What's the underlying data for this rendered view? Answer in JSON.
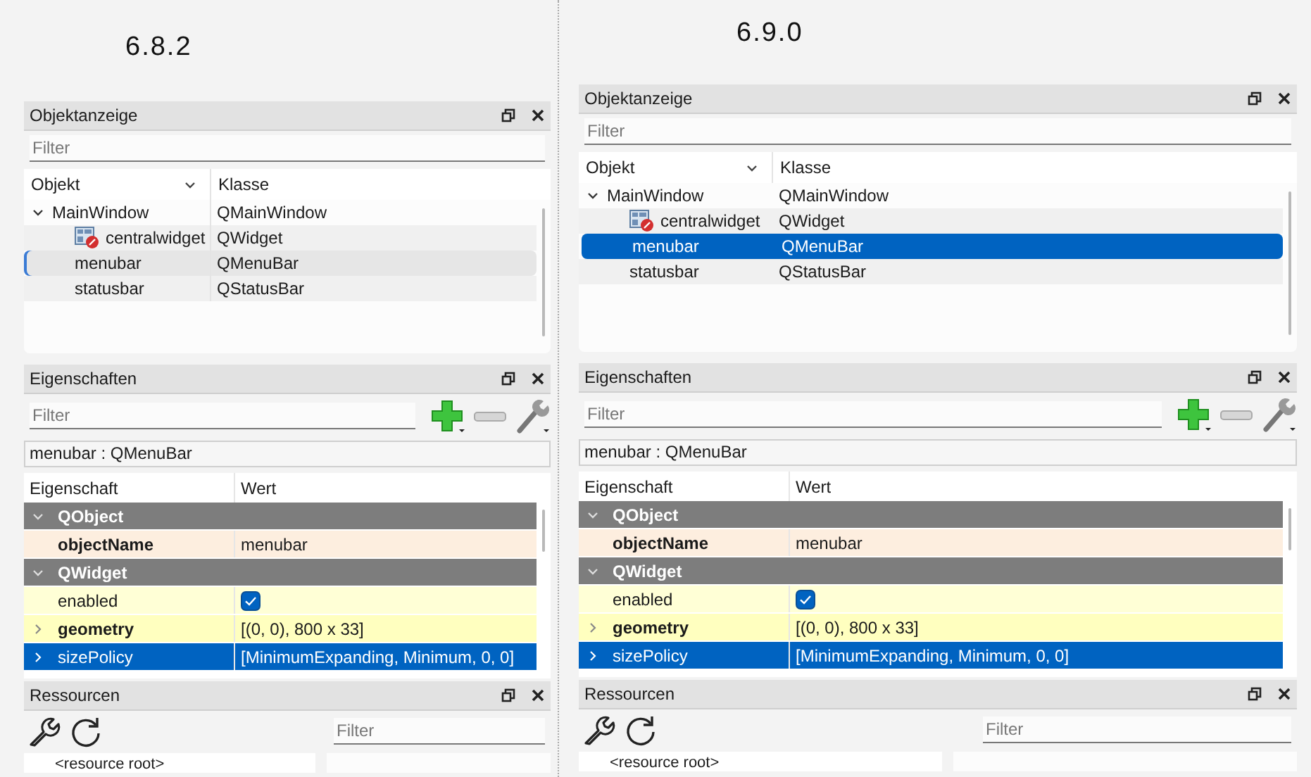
{
  "panes": [
    {
      "version": "6.8.2",
      "object_inspector": {
        "title": "Objektanzeige",
        "filter_placeholder": "Filter",
        "columns": [
          "Objekt",
          "Klasse"
        ],
        "rows": [
          {
            "name": "MainWindow",
            "class": "QMainWindow",
            "selected": false,
            "expanded": true,
            "children": [
              {
                "name": "centralwidget",
                "class": "QWidget",
                "selected": false
              },
              {
                "name": "menubar",
                "class": "QMenuBar",
                "selected": true
              },
              {
                "name": "statusbar",
                "class": "QStatusBar",
                "selected": false
              }
            ]
          }
        ]
      },
      "property_editor": {
        "title": "Eigenschaften",
        "filter_placeholder": "Filter",
        "object_label": "menubar : QMenuBar",
        "columns": [
          "Eigenschaft",
          "Wert"
        ],
        "rows": [
          {
            "kind": "group",
            "name": "QObject",
            "expanded": true
          },
          {
            "kind": "property",
            "name": "objectName",
            "value": "menubar",
            "modified": true,
            "expandable": false,
            "selected": false,
            "color": "#fdeedf"
          },
          {
            "kind": "group",
            "name": "QWidget",
            "expanded": true
          },
          {
            "kind": "checkbox",
            "name": "enabled",
            "checked": true,
            "modified": false,
            "expandable": false,
            "selected": false,
            "color": "#ffffd6"
          },
          {
            "kind": "property",
            "name": "geometry",
            "value": "[(0, 0), 800 x 33]",
            "modified": true,
            "expandable": true,
            "selected": false,
            "color": "#ffffbf"
          },
          {
            "kind": "property",
            "name": "sizePolicy",
            "value": "[MinimumExpanding, Minimum, 0, 0]",
            "modified": false,
            "expandable": true,
            "selected": true
          }
        ]
      },
      "resources": {
        "title": "Ressourcen",
        "filter_placeholder": "Filter",
        "root": "<resource root>"
      }
    },
    {
      "version": "6.9.0",
      "object_inspector": {
        "title": "Objektanzeige",
        "filter_placeholder": "Filter",
        "columns": [
          "Objekt",
          "Klasse"
        ],
        "rows": [
          {
            "name": "MainWindow",
            "class": "QMainWindow",
            "selected": false,
            "expanded": true,
            "children": [
              {
                "name": "centralwidget",
                "class": "QWidget",
                "selected": false
              },
              {
                "name": "menubar",
                "class": "QMenuBar",
                "selected": true
              },
              {
                "name": "statusbar",
                "class": "QStatusBar",
                "selected": false
              }
            ]
          }
        ]
      },
      "property_editor": {
        "title": "Eigenschaften",
        "filter_placeholder": "Filter",
        "object_label": "menubar : QMenuBar",
        "columns": [
          "Eigenschaft",
          "Wert"
        ],
        "rows": [
          {
            "kind": "group",
            "name": "QObject",
            "expanded": true
          },
          {
            "kind": "property",
            "name": "objectName",
            "value": "menubar",
            "modified": true,
            "expandable": false,
            "selected": false,
            "color": "#fdeedf"
          },
          {
            "kind": "group",
            "name": "QWidget",
            "expanded": true
          },
          {
            "kind": "checkbox",
            "name": "enabled",
            "checked": true,
            "modified": false,
            "expandable": false,
            "selected": false,
            "color": "#ffffd6"
          },
          {
            "kind": "property",
            "name": "geometry",
            "value": "[(0, 0), 800 x 33]",
            "modified": true,
            "expandable": true,
            "selected": false,
            "color": "#ffffbf"
          },
          {
            "kind": "property",
            "name": "sizePolicy",
            "value": "[MinimumExpanding, Minimum, 0, 0]",
            "modified": false,
            "expandable": true,
            "selected": true
          }
        ]
      },
      "resources": {
        "title": "Ressourcen",
        "filter_placeholder": "Filter",
        "root": "<resource root>"
      }
    }
  ]
}
